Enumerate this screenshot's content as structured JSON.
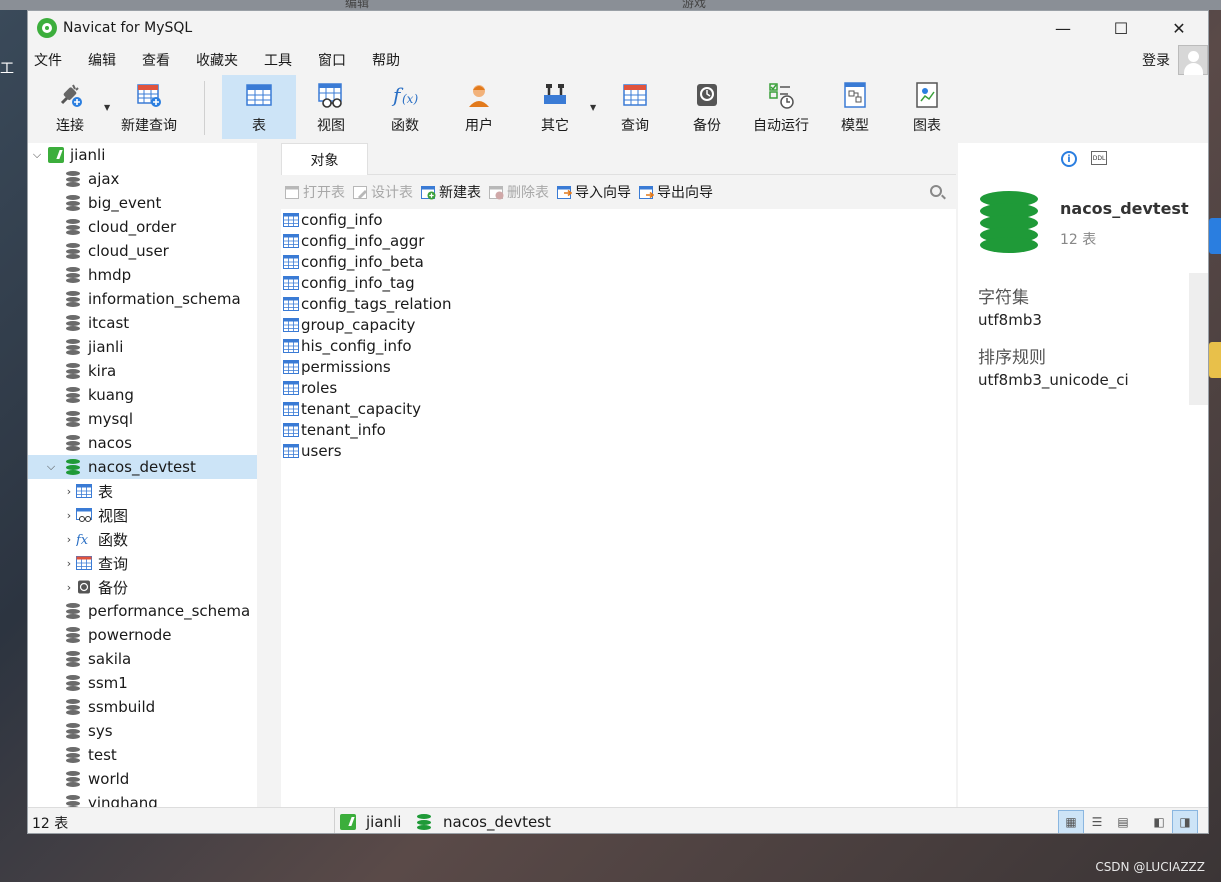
{
  "desktop": {
    "top_labels": [
      "编辑",
      "游戏"
    ],
    "left_char": "工",
    "watermark": "CSDN @LUCIAZZZ"
  },
  "window": {
    "title": "Navicat for MySQL",
    "controls": {
      "minimize": "—",
      "maximize": "☐",
      "close": "✕"
    }
  },
  "menu": {
    "items": [
      "文件",
      "编辑",
      "查看",
      "收藏夹",
      "工具",
      "窗口",
      "帮助"
    ],
    "login": "登录"
  },
  "toolbar": {
    "buttons": [
      {
        "label": "连接",
        "icon": "plug-icon"
      },
      {
        "label": "新建查询",
        "icon": "new-query-icon"
      },
      {
        "label": "表",
        "icon": "table-icon",
        "active": true
      },
      {
        "label": "视图",
        "icon": "view-icon"
      },
      {
        "label": "函数",
        "icon": "function-icon"
      },
      {
        "label": "用户",
        "icon": "user-icon"
      },
      {
        "label": "其它",
        "icon": "tools-icon"
      },
      {
        "label": "查询",
        "icon": "query-icon"
      },
      {
        "label": "备份",
        "icon": "backup-icon"
      },
      {
        "label": "自动运行",
        "icon": "schedule-icon"
      },
      {
        "label": "模型",
        "icon": "model-icon"
      },
      {
        "label": "图表",
        "icon": "chart-icon"
      }
    ]
  },
  "sidebar": {
    "connection": "jianli",
    "databases": [
      "ajax",
      "big_event",
      "cloud_order",
      "cloud_user",
      "hmdp",
      "information_schema",
      "itcast",
      "jianli",
      "kira",
      "kuang",
      "mysql",
      "nacos"
    ],
    "selected_db": "nacos_devtest",
    "sub_items": [
      "表",
      "视图",
      "函数",
      "查询",
      "备份"
    ],
    "databases_after": [
      "performance_schema",
      "powernode",
      "sakila",
      "ssm1",
      "ssmbuild",
      "sys",
      "test",
      "world",
      "yinghang"
    ]
  },
  "objects": {
    "tab": "对象",
    "actions": [
      {
        "label": "打开表",
        "enabled": false
      },
      {
        "label": "设计表",
        "enabled": false
      },
      {
        "label": "新建表",
        "enabled": true
      },
      {
        "label": "删除表",
        "enabled": false
      },
      {
        "label": "导入向导",
        "enabled": true
      },
      {
        "label": "导出向导",
        "enabled": true
      }
    ],
    "tables": [
      "config_info",
      "config_info_aggr",
      "config_info_beta",
      "config_info_tag",
      "config_tags_relation",
      "group_capacity",
      "his_config_info",
      "permissions",
      "roles",
      "tenant_capacity",
      "tenant_info",
      "users"
    ]
  },
  "info_panel": {
    "db_name": "nacos_devtest",
    "table_count": "12 表",
    "charset_label": "字符集",
    "charset": "utf8mb3",
    "collation_label": "排序规则",
    "collation": "utf8mb3_unicode_ci",
    "ddl": "DDL"
  },
  "status": {
    "count": "12 表",
    "connection": "jianli",
    "database": "nacos_devtest"
  },
  "colors": {
    "accent": "#cde4f7",
    "db_green": "#1f9a38",
    "db_gray": "#6b6b6b"
  }
}
